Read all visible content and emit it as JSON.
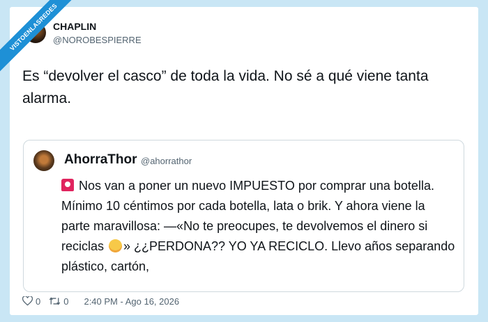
{
  "watermark": "VISTOENLASREDES",
  "tweet": {
    "name": "CHAPLIN",
    "handle": "@NOROBESPIERRE",
    "text": "Es “devolver el casco” de toda la vida. No sé a qué viene tanta alarma."
  },
  "quoted_tweet": {
    "name": "AhorraThor",
    "handle": "@ahorrathor",
    "text_part1": "Nos van a poner un nuevo IMPUESTO por comprar una botella. Mínimo 10 céntimos por cada botella, lata o brik. Y ahora viene la parte maravillosa: —«No te preocupes, te devolvemos el dinero si reciclas",
    "text_part2": "» ¿¿PERDONA?? YO YA RECICLO. Llevo años separando plástico, cartón,",
    "emojis": [
      "rotating-light-icon",
      "hugging-face-icon"
    ]
  },
  "footer": {
    "likes": "0",
    "retweets": "0",
    "timestamp": "2:40 PM - Ago 16, 2026"
  },
  "colors": {
    "background": "#c9e6f5",
    "ribbon": "#1e90d6",
    "text": "#0f1419",
    "muted": "#536471",
    "border": "#cfd9de"
  }
}
